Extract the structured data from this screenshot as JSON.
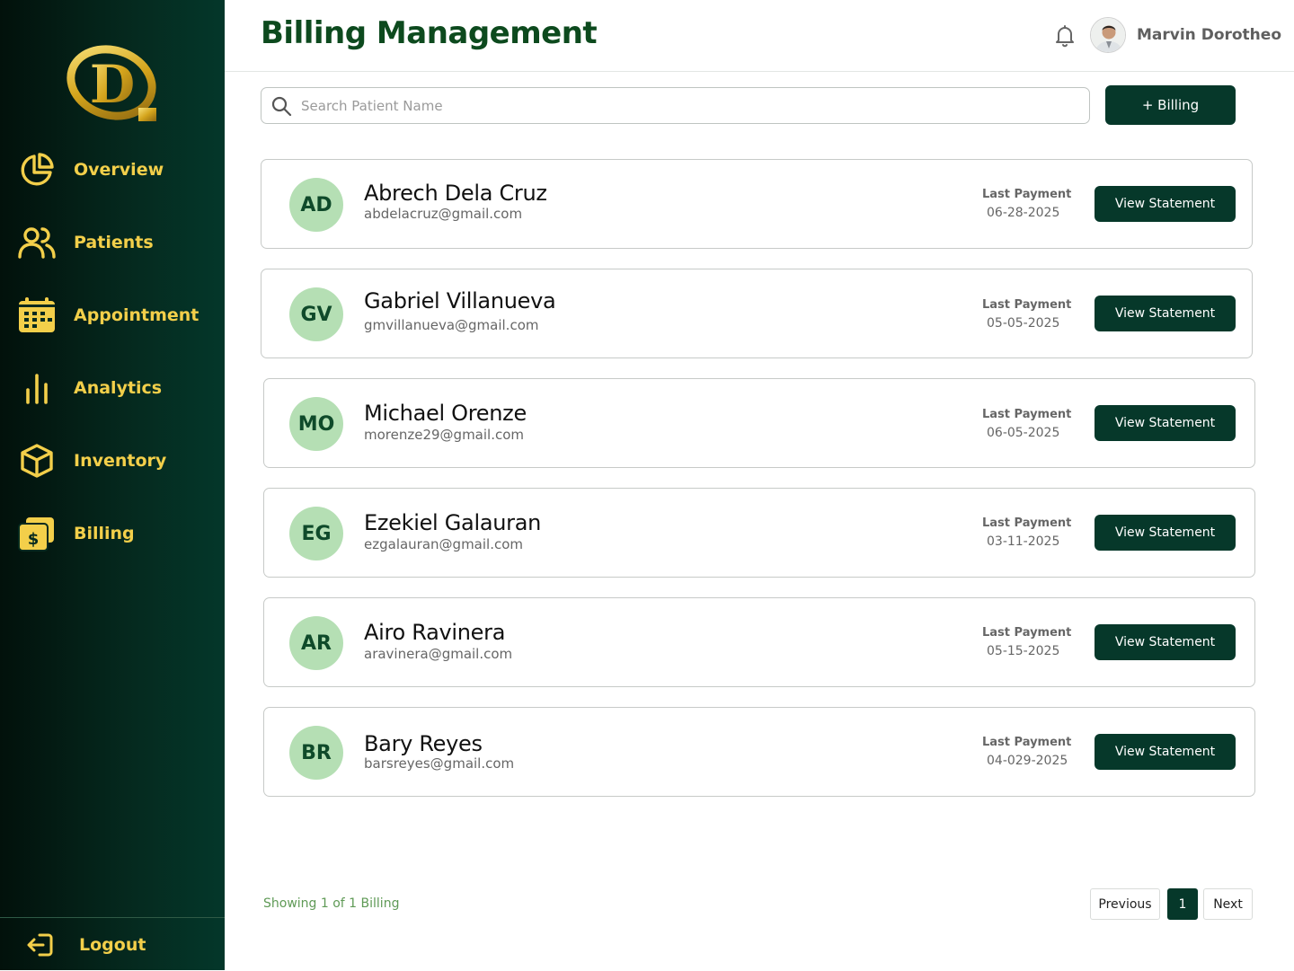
{
  "sidebar": {
    "logo_letter": "D",
    "items": [
      {
        "label": "Overview",
        "icon": "pie-chart-icon"
      },
      {
        "label": "Patients",
        "icon": "users-icon"
      },
      {
        "label": "Appointment",
        "icon": "calendar-icon"
      },
      {
        "label": "Analytics",
        "icon": "bar-chart-icon"
      },
      {
        "label": "Inventory",
        "icon": "box-icon"
      },
      {
        "label": "Billing",
        "icon": "billing-icon"
      }
    ],
    "logout_label": "Logout",
    "text_color": "#f3cf4a",
    "background": "#052a1f"
  },
  "header": {
    "title": "Billing Management",
    "user_name": "Marvin Dorotheo",
    "title_color": "#0d4a1e"
  },
  "toolbar": {
    "search_placeholder": "Search Patient Name",
    "search_value": "",
    "add_label": "+ Billing"
  },
  "billing_list": {
    "last_payment_label": "Last Payment",
    "view_label": "View Statement",
    "rows": [
      {
        "initials": "AD",
        "name": "Abrech Dela Cruz",
        "email": "abdelacruz@gmail.com",
        "last_payment": "06-28-2025"
      },
      {
        "initials": "GV",
        "name": "Gabriel Villanueva",
        "email": "gmvillanueva@gmail.com",
        "last_payment": "05-05-2025"
      },
      {
        "initials": "MO",
        "name": "Michael Orenze",
        "email": "morenze29@gmail.com",
        "last_payment": "06-05-2025"
      },
      {
        "initials": "EG",
        "name": "Ezekiel Galauran",
        "email": "ezgalauran@gmail.com",
        "last_payment": "03-11-2025"
      },
      {
        "initials": "AR",
        "name": "Airo Ravinera",
        "email": "aravinera@gmail.com",
        "last_payment": "05-15-2025"
      },
      {
        "initials": "BR",
        "name": "Bary Reyes",
        "email": "barsreyes@gmail.com",
        "last_payment": "04-029-2025"
      }
    ]
  },
  "pagination": {
    "showing_text": "Showing 1 of 1 Billing",
    "previous_label": "Previous",
    "current_page": "1",
    "next_label": "Next"
  },
  "colors": {
    "primary_button": "#06382a",
    "avatar_bg": "#b5dfb4",
    "accent_gold": "#f3cf4a"
  }
}
